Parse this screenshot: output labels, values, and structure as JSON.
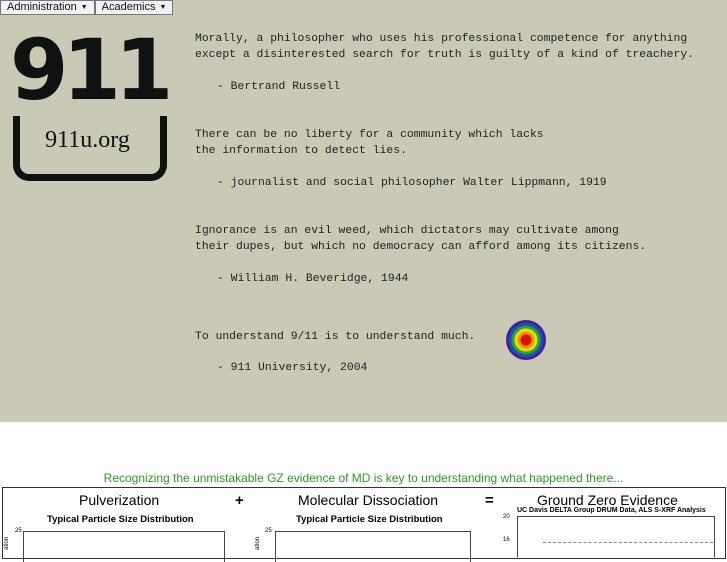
{
  "menu": {
    "administration": "Administration",
    "academics": "Academics"
  },
  "logo": {
    "number": "911",
    "url": "911u.org"
  },
  "quotes": [
    {
      "text": "Morally, a philosopher who uses his professional competence for anything\nexcept a disinterested search for truth is guilty of a kind of treachery.",
      "attribution": "- Bertrand Russell"
    },
    {
      "text": "There can be no liberty for a community which lacks\nthe information to detect lies.",
      "attribution": "- journalist and social philosopher Walter Lippmann, 1919"
    },
    {
      "text": "Ignorance is an evil weed, which dictators may cultivate among\ntheir dupes, but which no democracy can afford among its citizens.",
      "attribution": "- William H. Beveridge, 1944"
    },
    {
      "text": "To understand 9/11 is to understand much.",
      "attribution": "- 911 University, 2004"
    }
  ],
  "tagline": "Recognizing the unmistakable GZ evidence of MD is key to understanding what happened there...",
  "evidence": {
    "col1_title": "Pulverization",
    "plus": "+",
    "col2_title": "Molecular Dissociation",
    "equals": "=",
    "col3_title": "Ground Zero Evidence",
    "chart1_subtitle": "Typical Particle Size Distribution",
    "chart2_subtitle": "Typical Particle Size Distribution",
    "chart3_subtitle": "UC Davis DELTA Group DRUM Data,  ALS S-XRF Analysis",
    "chart1_ytick": "25",
    "chart2_ytick": "25",
    "chart3_ytick_top": "20",
    "chart3_ytick_mid": "16",
    "side_label": "ation"
  }
}
